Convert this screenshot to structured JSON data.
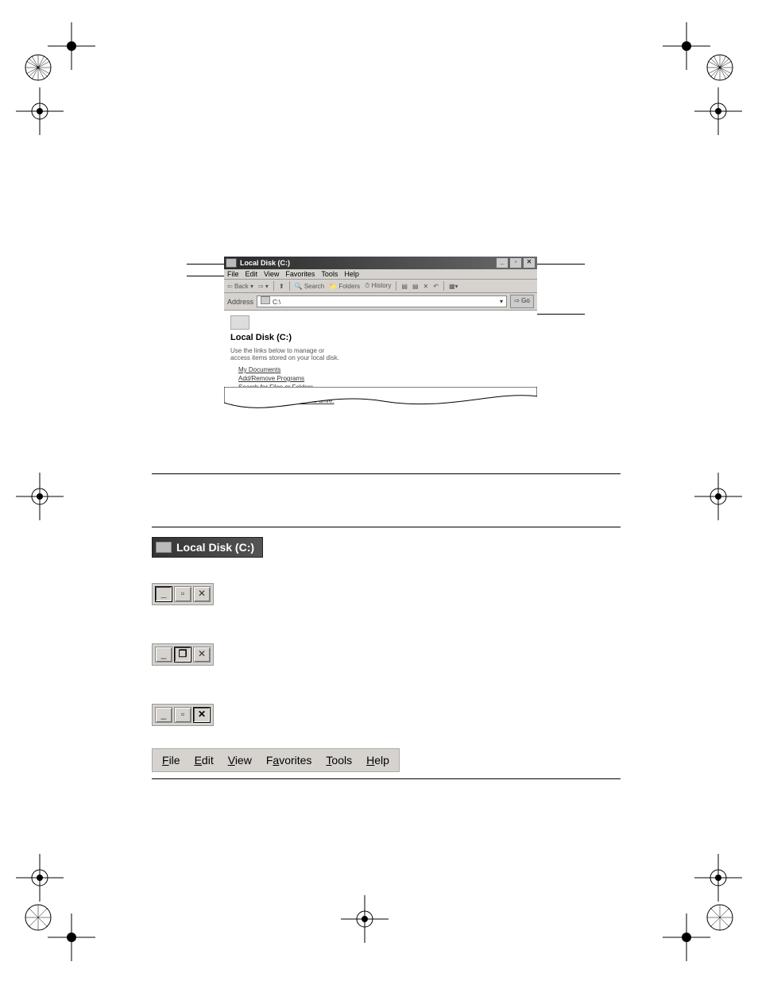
{
  "screenshot": {
    "title": "Local Disk (C:)",
    "menu": [
      "File",
      "Edit",
      "View",
      "Favorites",
      "Tools",
      "Help"
    ],
    "toolbar": {
      "back": "Back",
      "search": "Search",
      "folders": "Folders",
      "history": "History"
    },
    "address_label": "Address",
    "address_value": "C:\\",
    "go_label": "Go",
    "panel_heading": "Local Disk (C:)",
    "hint": "Use the links below to manage or access items stored on your local disk.",
    "links": {
      "my_documents": "My Documents",
      "add_remove": "Add/Remove Programs",
      "search": "Search for Files or Folders"
    },
    "view_all": "View the entire contents of this drive."
  },
  "table": {
    "title_chip": "Local Disk (C:)",
    "buttons": {
      "minimize": "_",
      "maximize": "▫",
      "restore": "❐",
      "close": "✕"
    },
    "menu": {
      "file": "File",
      "edit": "Edit",
      "view": "View",
      "favorites": "Favorites",
      "tools": "Tools",
      "help": "Help"
    }
  }
}
